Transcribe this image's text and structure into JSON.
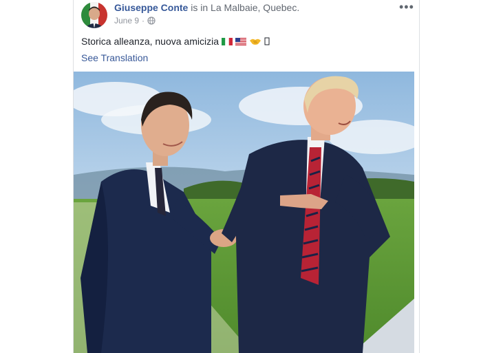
{
  "post": {
    "author": "Giuseppe Conte",
    "header_text": "is in La Malbaie, Quebec.",
    "date": "June 9",
    "privacy_icon": "globe-icon",
    "more_label": "•••",
    "text": "Storica alleanza, nuova amicizia",
    "emojis": [
      "flag-italy-icon",
      "flag-usa-icon",
      "handshake-icon",
      "unknown-glyph-box"
    ],
    "see_translation": "See Translation"
  },
  "colors": {
    "link": "#365899",
    "meta": "#90949c",
    "text": "#1d2129",
    "sky": "#aacbe8",
    "grass": "#5f9a3a"
  }
}
